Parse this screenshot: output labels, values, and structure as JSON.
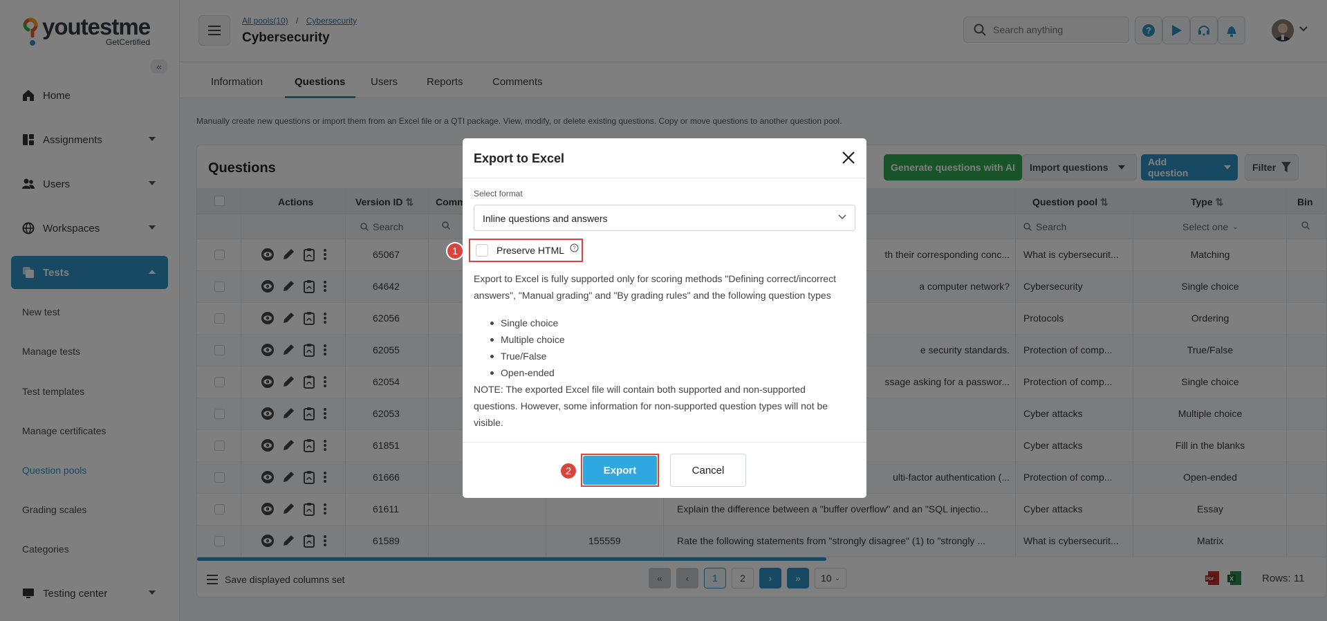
{
  "brand": {
    "name": "youtestme",
    "sub": "GetCertified"
  },
  "sidebar": {
    "items": [
      {
        "label": "Home"
      },
      {
        "label": "Assignments"
      },
      {
        "label": "Users"
      },
      {
        "label": "Workspaces"
      },
      {
        "label": "Tests"
      },
      {
        "label": "Testing center"
      }
    ],
    "subitems": [
      "New test",
      "Manage tests",
      "Test templates",
      "Manage certificates",
      "Question pools",
      "Grading scales",
      "Categories"
    ]
  },
  "header": {
    "breadcrumb": [
      "All pools(10)",
      "Cybersecurity"
    ],
    "separator": "/",
    "title": "Cybersecurity",
    "search_placeholder": "Search anything"
  },
  "tabs": [
    "Information",
    "Questions",
    "Users",
    "Reports",
    "Comments"
  ],
  "description": "Manually create new questions or import them from an Excel file or a QTI package. View, modify, or delete existing questions. Copy or move questions to another question pool.",
  "questions": {
    "title": "Questions",
    "buttons": {
      "generate": "Generate questions with AI",
      "import": "Import questions",
      "add": "Add question",
      "filter": "Filter"
    },
    "columns": {
      "actions": "Actions",
      "version": "Version ID",
      "comm": "Comm",
      "pool": "Question pool",
      "type": "Type",
      "bin": "Bin"
    },
    "filters": {
      "search": "Search",
      "select": "Select one"
    },
    "rows": [
      {
        "version": "65067",
        "id": "",
        "text": "th their corresponding conc...",
        "pool": "What is cybersecurit...",
        "type": "Matching"
      },
      {
        "version": "64642",
        "id": "",
        "text": "a computer network?",
        "pool": "Cybersecurity",
        "type": "Single choice"
      },
      {
        "version": "62056",
        "id": "",
        "text": "",
        "pool": "Protocols",
        "type": "Ordering"
      },
      {
        "version": "62055",
        "id": "",
        "text": "e security standards.",
        "pool": "Protection of comp...",
        "type": "True/False"
      },
      {
        "version": "62054",
        "id": "",
        "text": "ssage asking for a passwor...",
        "pool": "Protection of comp...",
        "type": "Single choice"
      },
      {
        "version": "62053",
        "id": "",
        "text": "",
        "pool": "Cyber attacks",
        "type": "Multiple choice"
      },
      {
        "version": "61851",
        "id": "",
        "text": "",
        "pool": "Cyber attacks",
        "type": "Fill in the blanks"
      },
      {
        "version": "61666",
        "id": "",
        "text": "ulti-factor authentication (...",
        "pool": "Protection of comp...",
        "type": "Open-ended"
      },
      {
        "version": "61611",
        "id": "",
        "text": "Explain the difference between a \"buffer overflow\" and an \"SQL injectio...",
        "pool": "Cyber attacks",
        "type": "Essay"
      },
      {
        "version": "61589",
        "id": "155559",
        "text": "Rate the following statements from \"strongly disagree\" (1) to \"strongly ...",
        "pool": "What is cybersecurit...",
        "type": "Matrix"
      }
    ],
    "footer": {
      "save_columns": "Save displayed columns set",
      "pages": [
        "1",
        "2"
      ],
      "per_page": "10",
      "rows": "Rows: 11"
    }
  },
  "modal": {
    "title": "Export to Excel",
    "format_label": "Select format",
    "format_value": "Inline questions and answers",
    "preserve_html": "Preserve HTML",
    "info": "Export to Excel is fully supported only for scoring methods \"Defining correct/incorrect answers\", \"Manual grading\" and \"By grading rules\" and the following question types",
    "types": [
      "Single choice",
      "Multiple choice",
      "True/False",
      "Open-ended"
    ],
    "note": "NOTE: The exported Excel file will contain both supported and non-supported questions. However, some information for non-supported question types will not be visible.",
    "export": "Export",
    "cancel": "Cancel"
  },
  "annotations": [
    "1",
    "2"
  ],
  "colors": {
    "primary": "#2f93c4",
    "green": "#2fa84f",
    "highlight": "#d9453d",
    "export": "#2fa7e0"
  }
}
